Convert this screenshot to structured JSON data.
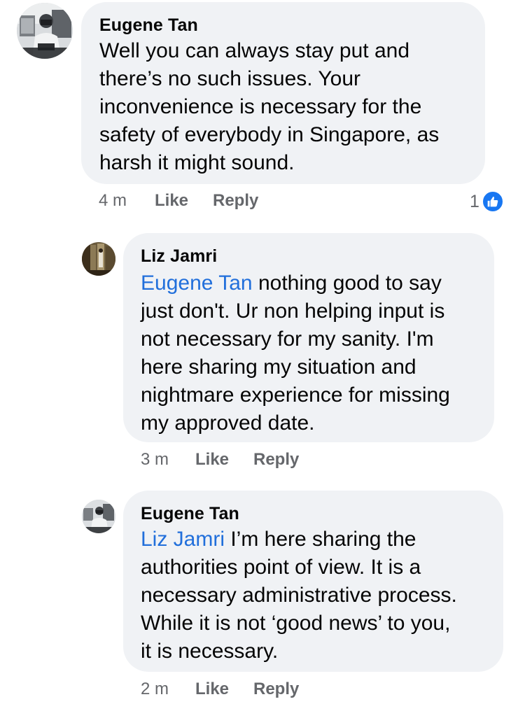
{
  "comments": [
    {
      "author": "Eugene Tan",
      "mention": "",
      "text": "Well you can always stay put and there’s no such issues. Your inconvenience is necessary for the safety of everybody in Singapore, as harsh it might sound.",
      "lines": [
        "Well you can always stay put and",
        "there’s no such issues. Your",
        "inconvenience is necessary for the",
        "safety of everybody in Singapore, as",
        "harsh it might sound."
      ],
      "time": "4 m",
      "like_label": "Like",
      "reply_label": "Reply",
      "reaction_count": "1",
      "reaction_icon": "thumbs-up-icon"
    },
    {
      "author": "Liz Jamri",
      "mention": "Eugene Tan",
      "text": "nothing good to say just don't. Ur non helping input is not necessary for my sanity. I'm here sharing my situation and nightmare experience for missing my approved date.",
      "lines": [
        " nothing good to say",
        "just don't. Ur non helping input is",
        "not necessary for my sanity. I'm",
        "here sharing my situation and",
        "nightmare experience for missing",
        "my approved date."
      ],
      "time": "3 m",
      "like_label": "Like",
      "reply_label": "Reply"
    },
    {
      "author": "Eugene Tan",
      "mention": "Liz Jamri",
      "text": "I’m here sharing the authorities point of view. It is a necessary administrative process. While it is not ‘good news’ to you, it is necessary.",
      "lines": [
        " I’m here sharing the",
        "authorities point of view. It is a",
        "necessary administrative process.",
        "While it is not ‘good news’ to you,",
        "it is necessary."
      ],
      "time": "2 m",
      "like_label": "Like",
      "reply_label": "Reply"
    }
  ],
  "colors": {
    "bubble_bg": "#f0f2f5",
    "mention": "#216fdb",
    "meta_text": "#65676b",
    "like_badge": "#1877f2"
  }
}
